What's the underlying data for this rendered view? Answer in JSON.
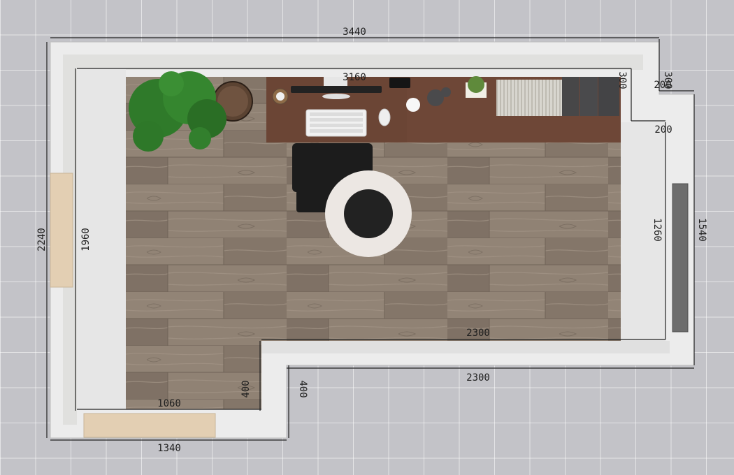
{
  "plan": {
    "dimensions": {
      "outer_top": "3440",
      "inner_top": "3160",
      "outer_left": "2240",
      "inner_left": "1960",
      "outer_right": "1540",
      "inner_right": "1260",
      "notch_vertical_outer": "300",
      "notch_vertical_inner": "300",
      "notch_horizontal_top": "200",
      "notch_horizontal_bottom": "200",
      "bottom_step_inner": "2300",
      "bottom_step_outer": "2300",
      "step_inner_vertical": "400",
      "step_outer_vertical": "400",
      "bottom_inner": "1060",
      "bottom_outer": "1340"
    },
    "colors": {
      "grid_background": "#c3c3c8",
      "wall": "#eeeeee",
      "floor": "#8a7b6f",
      "desk": "#6b4535",
      "rug_ring": "#ece7e3",
      "rug_center": "#222222",
      "plant": "#2f7a2a",
      "door": "#e3cfb3"
    },
    "furniture": [
      "desk",
      "monitor",
      "keyboard",
      "mouse",
      "office-chair",
      "round-rug",
      "potted-plant",
      "side-table",
      "desk-lamp",
      "bookshelf",
      "radiator",
      "door",
      "window"
    ]
  }
}
